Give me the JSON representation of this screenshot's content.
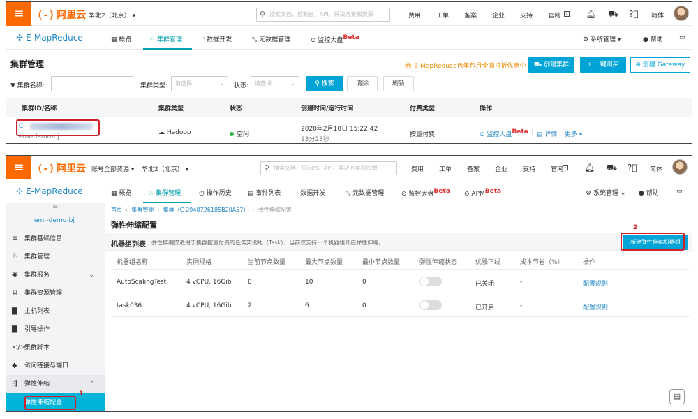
{
  "common": {
    "menu_icon": "≡",
    "logo": "阿里云",
    "logo_mark": "(-)",
    "search_placeholder": "搜索文档、控制台、API、解决方案和资源",
    "nav": [
      "费用",
      "工单",
      "备案",
      "企业",
      "支持",
      "官网"
    ],
    "lang": "简体",
    "product": "E-MapReduce",
    "system_manage": "系统管理",
    "help": "帮助",
    "beta": "Beta"
  },
  "panel1": {
    "region": "华北2（北京）",
    "tabs": [
      "概览",
      "集群管理",
      "数据开发",
      "元数据管理",
      "监控大盘"
    ],
    "page_title": "集群管理",
    "promo": "E-MapReduce包年包月全面打折优惠中",
    "buttons": {
      "create_cluster": "创建集群",
      "quick_buy": "一键购买",
      "create_gateway": "创建 Gateway"
    },
    "filter": {
      "name_label": "集群名称:",
      "type_label": "集群类型:",
      "type_placeholder": "请选择",
      "status_label": "状态:",
      "status_placeholder": "请选择",
      "search_btn": "搜索",
      "clear_btn": "清除",
      "refresh_btn": "刷新"
    },
    "table": {
      "headers": [
        "集群ID/名称",
        "集群类型",
        "状态",
        "创建时间/运行时间",
        "付费类型",
        "操作"
      ],
      "row": {
        "id": "C-",
        "name": "emr-demo-bj",
        "type": "Hadoop",
        "status": "空闲",
        "created": "2020年2月10日 15:22:42",
        "runtime": "13分23秒",
        "pay": "按量付费",
        "op_monitor": "监控大盘",
        "op_detail": "详情",
        "op_more": "更多"
      }
    }
  },
  "panel2": {
    "region_prefix": "账号全部资源",
    "region": "华北2（北京）",
    "tabs": [
      "概览",
      "集群管理",
      "操作历史",
      "事件列表",
      "数据开发",
      "元数据管理",
      "监控大盘",
      "APM"
    ],
    "sidebar": {
      "cluster_name": "emr-demo-bj",
      "items": [
        "集群基础信息",
        "集群管理",
        "集群服务",
        "集群资源管理",
        "主机列表",
        "引导操作",
        "集群脚本",
        "访问链接与端口",
        "弹性伸缩",
        "弹性伸缩配置"
      ]
    },
    "breadcrumb": [
      "首页",
      "集群管理",
      "集群（C-2948726185B20A57）",
      "弹性伸缩配置"
    ],
    "page_title": "弹性伸缩配置",
    "section_title": "机器组列表",
    "section_note": "弹性伸缩仅适用于集群按量付费的任务实例组（Task），当前仅支持一个机器组开启弹性伸缩。",
    "new_button": "新建弹性伸缩机器组",
    "table": {
      "headers": [
        "机器组名称",
        "实例规格",
        "当前节点数量",
        "最大节点数量",
        "最小节点数量",
        "弹性伸缩状态",
        "优雅下线",
        "成本节省（%）",
        "操作"
      ],
      "rows": [
        {
          "name": "AutoScalingTest",
          "spec": "4 vCPU, 16Gib",
          "current": "0",
          "max": "10",
          "min": "0",
          "graceful": "已关闭",
          "saving": "-",
          "action": "配置规则"
        },
        {
          "name": "task036",
          "spec": "4 vCPU, 16Gib",
          "current": "2",
          "max": "6",
          "min": "0",
          "graceful": "已开启",
          "saving": "-",
          "action": "配置规则"
        }
      ]
    },
    "annotations": {
      "step1": "1",
      "step2": "2"
    }
  },
  "colors": {
    "brand": "#ff6a00",
    "primary": "#00a4d6",
    "highlight": "#d0202a",
    "active_tab": "#00a0b0"
  }
}
